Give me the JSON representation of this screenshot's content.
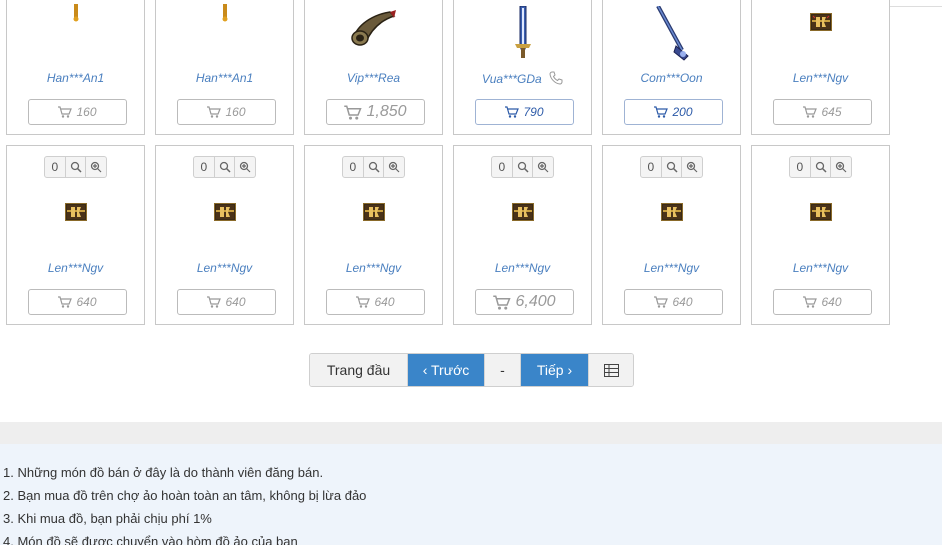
{
  "row1": [
    {
      "seller": "Han***An1",
      "price": "160",
      "item_icon": "amulet-icon",
      "phone": false,
      "style": "gray"
    },
    {
      "seller": "Han***An1",
      "price": "160",
      "item_icon": "amulet-icon",
      "phone": false,
      "style": "gray"
    },
    {
      "seller": "Vip***Rea",
      "price": "1,850",
      "item_icon": "horn-icon",
      "phone": false,
      "style": "big"
    },
    {
      "seller": "Vua***GDa",
      "price": "790",
      "item_icon": "sword-icon",
      "phone": true,
      "style": "blue"
    },
    {
      "seller": "Com***Oon",
      "price": "200",
      "item_icon": "staff-icon",
      "phone": false,
      "style": "blue"
    },
    {
      "seller": "Len***Ngv",
      "price": "645",
      "item_icon": "chest-icon",
      "phone": false,
      "style": "gray"
    }
  ],
  "row2": [
    {
      "seller": "Len***Ngv",
      "price": "640",
      "item_icon": "chest-icon",
      "count": "0",
      "style": "gray"
    },
    {
      "seller": "Len***Ngv",
      "price": "640",
      "item_icon": "chest-icon",
      "count": "0",
      "style": "gray"
    },
    {
      "seller": "Len***Ngv",
      "price": "640",
      "item_icon": "chest-icon",
      "count": "0",
      "style": "gray"
    },
    {
      "seller": "Len***Ngv",
      "price": "6,400",
      "item_icon": "chest-icon",
      "count": "0",
      "style": "big"
    },
    {
      "seller": "Len***Ngv",
      "price": "640",
      "item_icon": "chest-icon",
      "count": "0",
      "style": "gray"
    },
    {
      "seller": "Len***Ngv",
      "price": "640",
      "item_icon": "chest-icon",
      "count": "0",
      "style": "gray"
    }
  ],
  "pager": {
    "first": "Trang đầu",
    "prev": "‹ Trước",
    "current": "-",
    "next": "Tiếp ›",
    "grid_icon": "table-icon"
  },
  "notes": [
    "1. Những món đồ bán ở đây là do thành viên đăng bán.",
    "2. Bạn mua đồ trên chợ ảo hoàn toàn an tâm, không bị lừa đảo",
    "3. Khi mua đồ, bạn phải chịu phí 1%",
    "4. Món đồ sẽ được chuyển vào hòm đồ ảo của bạn"
  ],
  "colors": {
    "accent": "#3a85c9",
    "seller": "#4a7fbf",
    "price_gray": "#9a9a9a",
    "price_blue": "#2c5aa8",
    "notes_bg": "#eef4fb"
  }
}
